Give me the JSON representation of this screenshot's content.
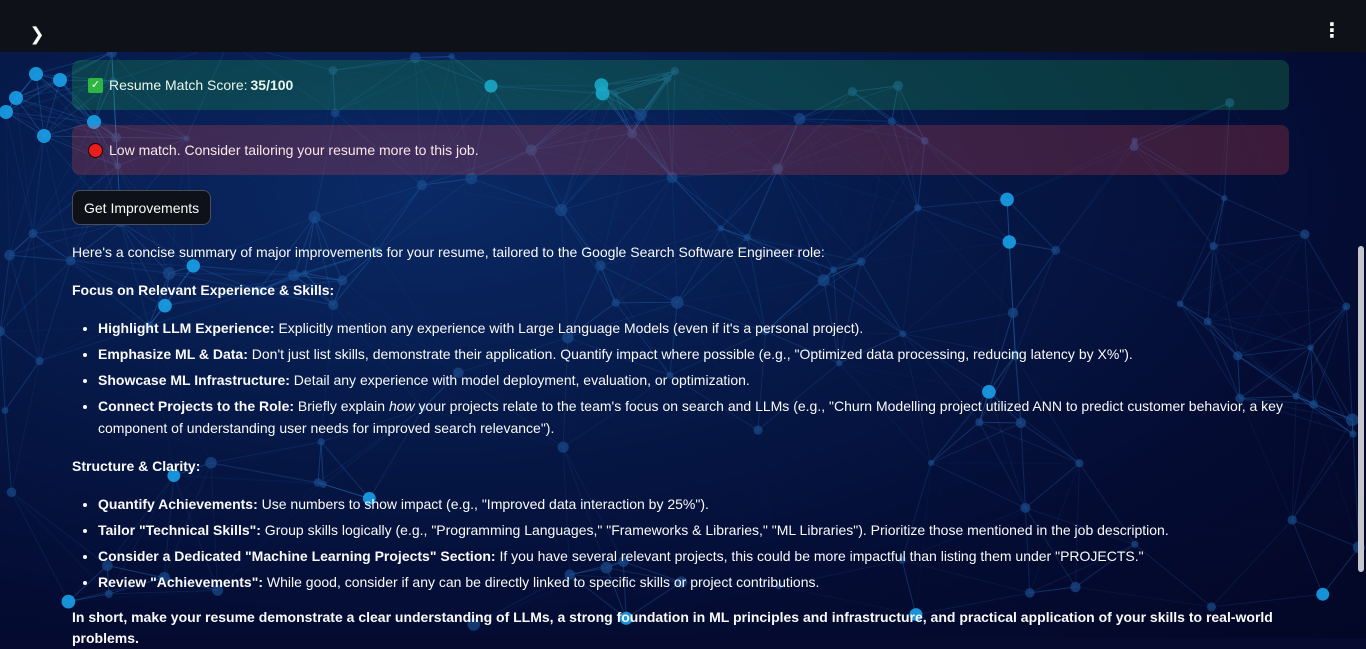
{
  "header": {
    "sidebar_toggle_icon": "chevron-right-icon",
    "menu_icon": "kebab-menu-icon"
  },
  "score_alert": {
    "label": "Resume Match Score: ",
    "score": "35/100",
    "icon": "check-mark-icon",
    "color": "#21c354"
  },
  "match_alert": {
    "text": "Low match. Consider tailoring your resume more to this job.",
    "icon": "red-circle-icon",
    "color": "#ff4b4b"
  },
  "improve_button": {
    "label": "Get Improvements"
  },
  "suggestions": {
    "intro": "Here's a concise summary of major improvements for your resume, tailored to the Google Search Software Engineer role:",
    "sections": [
      {
        "heading": "Focus on Relevant Experience & Skills:",
        "items": [
          {
            "title": "Highlight LLM Experience:",
            "text": " Explicitly mention any experience with Large Language Models (even if it's a personal project)."
          },
          {
            "title": "Emphasize ML & Data:",
            "text": " Don't just list skills, demonstrate their application. Quantify impact where possible (e.g., \"Optimized data processing, reducing latency by X%\")."
          },
          {
            "title": "Showcase ML Infrastructure:",
            "text": " Detail any experience with model deployment, evaluation, or optimization."
          },
          {
            "title": "Connect Projects to the Role:",
            "text_before": " Briefly explain ",
            "emphasis": "how",
            "text": " your projects relate to the team's focus on search and LLMs (e.g., \"Churn Modelling project utilized ANN to predict customer behavior, a key component of understanding user needs for improved search relevance\")."
          }
        ]
      },
      {
        "heading": "Structure & Clarity:",
        "items": [
          {
            "title": "Quantify Achievements:",
            "text": " Use numbers to show impact (e.g., \"Improved data interaction by 25%\")."
          },
          {
            "title": "Tailor \"Technical Skills\":",
            "text": " Group skills logically (e.g., \"Programming Languages,\" \"Frameworks & Libraries,\" \"ML Libraries\"). Prioritize those mentioned in the job description."
          },
          {
            "title": "Consider a Dedicated \"Machine Learning Projects\" Section:",
            "text": " If you have several relevant projects, this could be more impactful than listing them under \"PROJECTS.\""
          },
          {
            "title": "Review \"Achievements\":",
            "text": " While good, consider if any can be directly linked to specific skills or project contributions."
          }
        ]
      }
    ],
    "summary": "In short, make your resume demonstrate a clear understanding of LLMs, a strong foundation in ML principles and infrastructure, and practical application of your skills to real-world problems."
  }
}
